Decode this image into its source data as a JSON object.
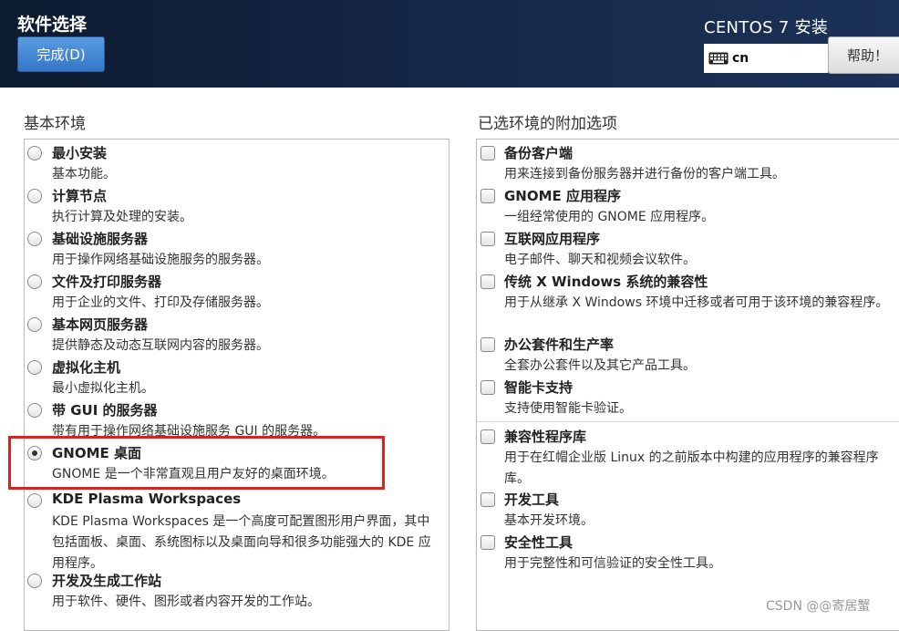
{
  "header": {
    "page_title": "软件选择",
    "done_label": "完成(D)",
    "product_title": "CENTOS 7 安装",
    "keyboard_layout": "cn",
    "help_label": "帮助！"
  },
  "left_section": {
    "label": "基本环境",
    "items": [
      {
        "title": "最小安装",
        "desc": "基本功能。",
        "selected": false
      },
      {
        "title": "计算节点",
        "desc": "执行计算及处理的安装。",
        "selected": false
      },
      {
        "title": "基础设施服务器",
        "desc": "用于操作网络基础设施服务的服务器。",
        "selected": false
      },
      {
        "title": "文件及打印服务器",
        "desc": "用于企业的文件、打印及存储服务器。",
        "selected": false
      },
      {
        "title": "基本网页服务器",
        "desc": "提供静态及动态互联网内容的服务器。",
        "selected": false
      },
      {
        "title": "虚拟化主机",
        "desc": "最小虚拟化主机。",
        "selected": false
      },
      {
        "title": "带 GUI 的服务器",
        "desc": "带有用于操作网络基础设施服务 GUI 的服务器。",
        "selected": false
      },
      {
        "title": "GNOME 桌面",
        "desc": "GNOME 是一个非常直观且用户友好的桌面环境。",
        "selected": true
      },
      {
        "title": "KDE Plasma Workspaces",
        "desc": "KDE Plasma Workspaces 是一个高度可配置图形用户界面，其中包括面板、桌面、系统图标以及桌面向导和很多功能强大的 KDE 应用程序。",
        "selected": false
      },
      {
        "title": "开发及生成工作站",
        "desc": "用于软件、硬件、图形或者内容开发的工作站。",
        "selected": false
      }
    ]
  },
  "right_section": {
    "label": "已选环境的附加选项",
    "items": [
      {
        "title": "备份客户端",
        "desc": "用来连接到备份服务器并进行备份的客户端工具。",
        "checked": false
      },
      {
        "title": "GNOME 应用程序",
        "desc": "一组经常使用的 GNOME 应用程序。",
        "checked": false
      },
      {
        "title": "互联网应用程序",
        "desc": "电子邮件、聊天和视频会议软件。",
        "checked": false
      },
      {
        "title": "传统 X Windows 系统的兼容性",
        "desc": "用于从继承 X Windows 环境中迁移或者可用于该环境的兼容程序。",
        "checked": false
      },
      {
        "title": "办公套件和生产率",
        "desc": "全套办公套件以及其它产品工具。",
        "checked": false
      },
      {
        "title": "智能卡支持",
        "desc": "支持使用智能卡验证。",
        "checked": false
      },
      {
        "title": "兼容性程序库",
        "desc": "用于在红帽企业版 Linux 的之前版本中构建的应用程序的兼容程序库。",
        "checked": false
      },
      {
        "title": "开发工具",
        "desc": "基本开发环境。",
        "checked": false
      },
      {
        "title": "安全性工具",
        "desc": "用于完整性和可信验证的安全性工具。",
        "checked": false
      }
    ]
  },
  "watermark": "CSDN @@寄居蟹",
  "colors": {
    "header_bg": "#16294a",
    "done_button": "#3f86d4",
    "highlight_border": "#e01f1f"
  }
}
